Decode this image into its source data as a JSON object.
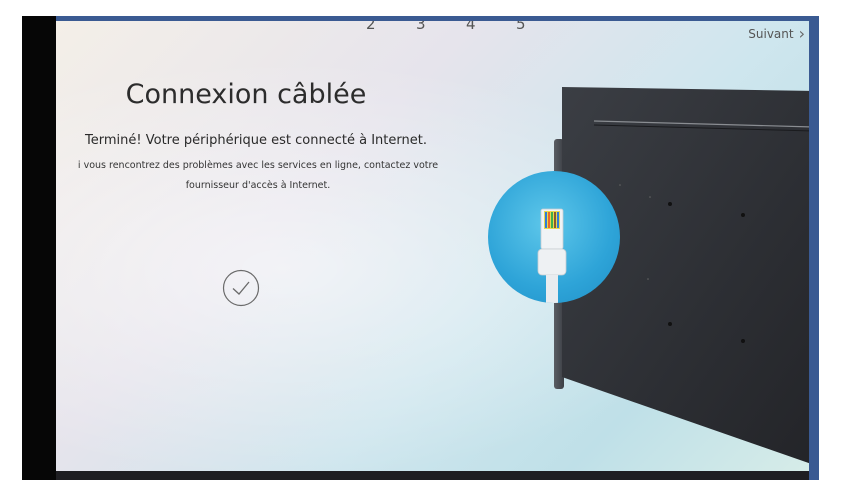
{
  "steps": [
    "2",
    "3",
    "4",
    "5"
  ],
  "nav": {
    "next_label": "Suivant",
    "next_icon": "chevron-right-icon"
  },
  "content": {
    "title": "Connexion câblée",
    "subtitle": "Terminé! Votre périphérique est connecté à Internet.",
    "desc_line1": "i vous rencontrez des problèmes avec les services en ligne, contactez votre",
    "desc_line2": "fournisseur d'accès à Internet."
  },
  "icons": {
    "status": "checkmark-circle-icon",
    "illustration": "ethernet-cable-icon"
  },
  "colors": {
    "frame_border": "#3a5a92",
    "accent_circle": "#2ea4d8",
    "tv_panel": "#2e3036"
  }
}
